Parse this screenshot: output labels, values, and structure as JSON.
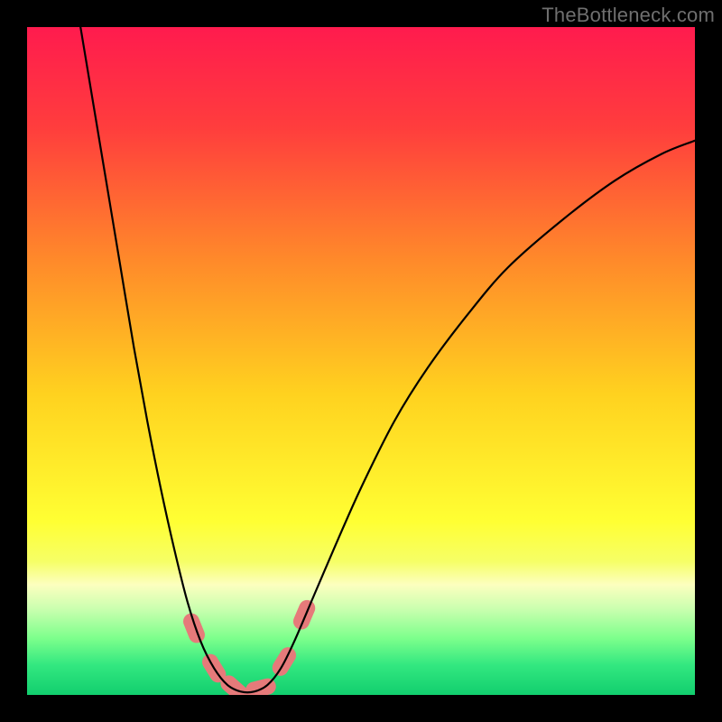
{
  "watermark": "TheBottleneck.com",
  "chart_data": {
    "type": "line",
    "title": "",
    "xlabel": "",
    "ylabel": "",
    "xlim": [
      0,
      100
    ],
    "ylim": [
      0,
      100
    ],
    "background_gradient": {
      "stops": [
        {
          "offset": 0.0,
          "color": "#ff1b4e"
        },
        {
          "offset": 0.15,
          "color": "#ff3d3d"
        },
        {
          "offset": 0.35,
          "color": "#ff8a2a"
        },
        {
          "offset": 0.55,
          "color": "#ffd21f"
        },
        {
          "offset": 0.74,
          "color": "#ffff33"
        },
        {
          "offset": 0.8,
          "color": "#f6ff66"
        },
        {
          "offset": 0.835,
          "color": "#fcffbf"
        },
        {
          "offset": 0.87,
          "color": "#ccffb0"
        },
        {
          "offset": 0.915,
          "color": "#7dff8c"
        },
        {
          "offset": 0.955,
          "color": "#33e880"
        },
        {
          "offset": 1.0,
          "color": "#12ce6e"
        }
      ]
    },
    "series": [
      {
        "name": "bottleneck-curve",
        "color": "#000000",
        "width": 2.2,
        "points": [
          {
            "x": 8.0,
            "y": 100.0
          },
          {
            "x": 10.0,
            "y": 88.0
          },
          {
            "x": 12.0,
            "y": 76.0
          },
          {
            "x": 14.0,
            "y": 64.0
          },
          {
            "x": 16.0,
            "y": 52.0
          },
          {
            "x": 18.0,
            "y": 41.0
          },
          {
            "x": 20.0,
            "y": 31.0
          },
          {
            "x": 22.0,
            "y": 22.0
          },
          {
            "x": 24.0,
            "y": 14.0
          },
          {
            "x": 26.0,
            "y": 8.0
          },
          {
            "x": 28.0,
            "y": 4.0
          },
          {
            "x": 30.0,
            "y": 1.5
          },
          {
            "x": 32.0,
            "y": 0.5
          },
          {
            "x": 34.0,
            "y": 0.5
          },
          {
            "x": 36.0,
            "y": 1.5
          },
          {
            "x": 38.0,
            "y": 4.0
          },
          {
            "x": 40.0,
            "y": 8.0
          },
          {
            "x": 43.0,
            "y": 15.0
          },
          {
            "x": 46.0,
            "y": 22.0
          },
          {
            "x": 50.0,
            "y": 31.0
          },
          {
            "x": 55.0,
            "y": 41.0
          },
          {
            "x": 60.0,
            "y": 49.0
          },
          {
            "x": 66.0,
            "y": 57.0
          },
          {
            "x": 72.0,
            "y": 64.0
          },
          {
            "x": 80.0,
            "y": 71.0
          },
          {
            "x": 88.0,
            "y": 77.0
          },
          {
            "x": 95.0,
            "y": 81.0
          },
          {
            "x": 100.0,
            "y": 83.0
          }
        ]
      }
    ],
    "markers": [
      {
        "x": 25.0,
        "y": 10.0,
        "color": "#e67a7a"
      },
      {
        "x": 28.0,
        "y": 4.0,
        "color": "#e67a7a"
      },
      {
        "x": 31.0,
        "y": 1.0,
        "color": "#e67a7a"
      },
      {
        "x": 35.0,
        "y": 1.0,
        "color": "#e67a7a"
      },
      {
        "x": 38.5,
        "y": 5.0,
        "color": "#e67a7a"
      },
      {
        "x": 41.5,
        "y": 12.0,
        "color": "#e67a7a"
      }
    ]
  }
}
